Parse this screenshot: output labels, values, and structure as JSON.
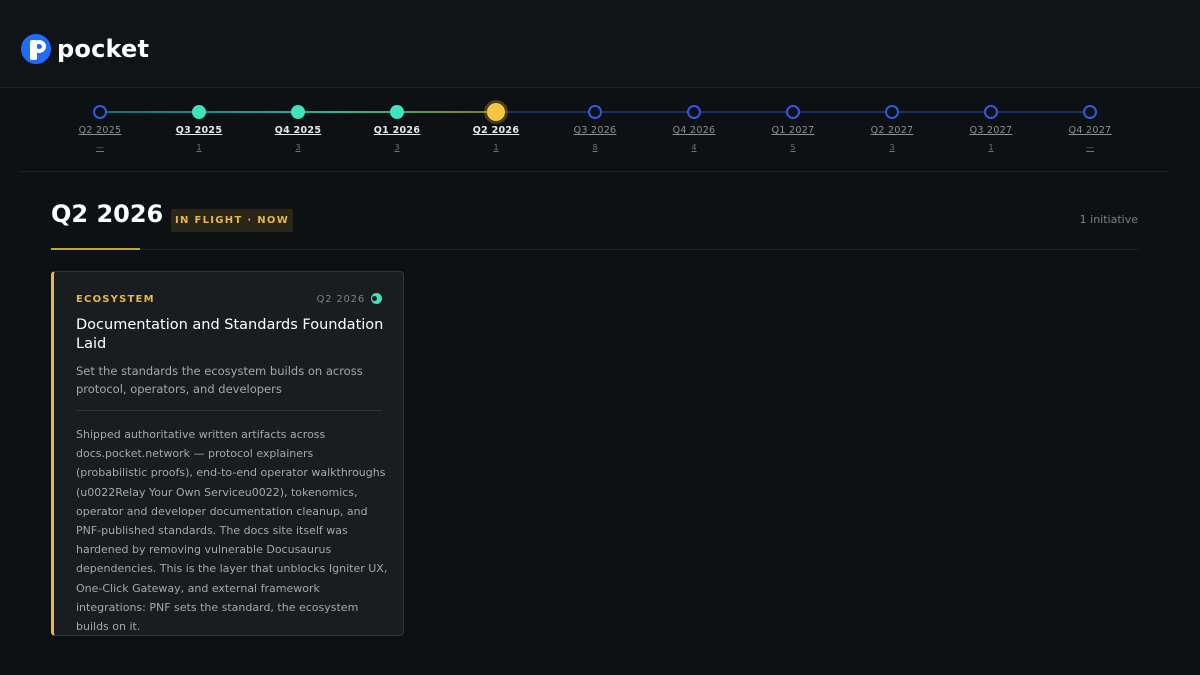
{
  "brand": {
    "name": "pocket",
    "accent": "#1f6bff"
  },
  "timeline": {
    "quarters": [
      {
        "label": "Q2 2025",
        "count": "—",
        "state": "future"
      },
      {
        "label": "Q3 2025",
        "count": "1",
        "state": "done"
      },
      {
        "label": "Q4 2025",
        "count": "3",
        "state": "done"
      },
      {
        "label": "Q1 2026",
        "count": "3",
        "state": "done"
      },
      {
        "label": "Q2 2026",
        "count": "1",
        "state": "current"
      },
      {
        "label": "Q3 2026",
        "count": "8",
        "state": "future"
      },
      {
        "label": "Q4 2026",
        "count": "4",
        "state": "future"
      },
      {
        "label": "Q1 2027",
        "count": "5",
        "state": "future"
      },
      {
        "label": "Q2 2027",
        "count": "3",
        "state": "future"
      },
      {
        "label": "Q3 2027",
        "count": "1",
        "state": "future"
      },
      {
        "label": "Q4 2027",
        "count": "—",
        "state": "future"
      }
    ],
    "colors": {
      "done": "#3fe3bd",
      "current": "#f5c542",
      "future": "#2f5be0"
    }
  },
  "section": {
    "title": "Q2 2026",
    "status": "IN FLIGHT · NOW",
    "count": "1 initiative"
  },
  "card": {
    "category": "ECOSYSTEM",
    "quarter": "Q2 2026",
    "title": "Documentation and Standards Foundation Laid",
    "summary": "Set the standards the ecosystem builds on across protocol, operators, and developers",
    "body": "Shipped authoritative written artifacts across docs.pocket.network — protocol explainers (probabilistic proofs), end-to-end operator walkthroughs (u0022Relay Your Own Serviceu0022), tokenomics, operator and developer documentation cleanup, and PNF-published standards. The docs site itself was hardened by removing vulnerable Docusaurus dependencies. This is the layer that unblocks Igniter UX, One-Click Gateway, and external framework integrations: PNF sets the standard, the ecosystem builds on it."
  }
}
